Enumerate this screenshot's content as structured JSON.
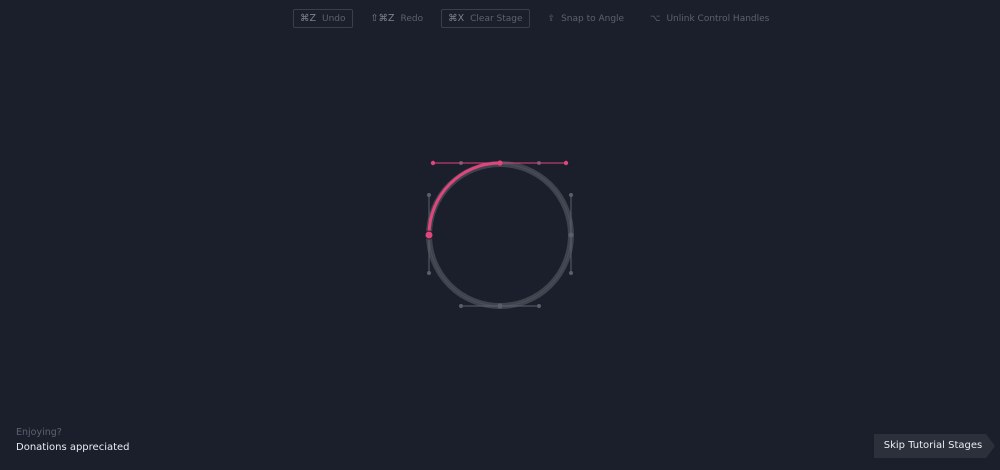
{
  "toolbar": {
    "undo": {
      "shortcut": "⌘Z",
      "label": "Undo"
    },
    "redo": {
      "shortcut": "⇧⌘Z",
      "label": "Redo"
    },
    "clear": {
      "shortcut": "⌘X",
      "label": "Clear Stage"
    },
    "snap": {
      "glyph": "⇪",
      "label": "Snap to Angle"
    },
    "unlink": {
      "glyph": "⌥",
      "label": "Unlink Control Handles"
    }
  },
  "footer": {
    "enjoying": "Enjoying?",
    "donations": "Donations appreciated"
  },
  "skip_button": {
    "label": "Skip Tutorial Stages"
  },
  "colors": {
    "background": "#1b1f2b",
    "path_accent": "#e0457b",
    "guide_circle": "#3f434d",
    "guide_handle": "#5a5f6b",
    "button_bg": "#2b303b"
  }
}
